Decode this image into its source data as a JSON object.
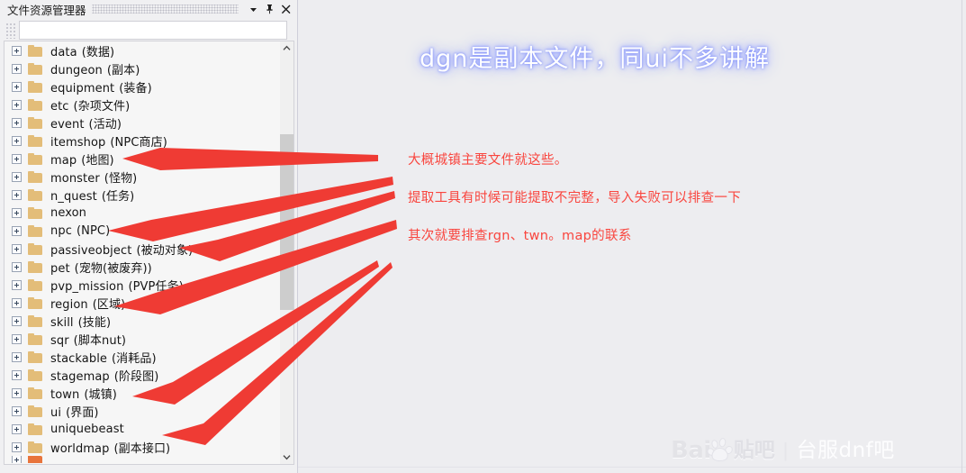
{
  "panel": {
    "title": "文件资源管理器",
    "titlebar_buttons": [
      {
        "name": "dropdown",
        "glyph": "▾"
      },
      {
        "name": "pin",
        "glyph": "pin"
      },
      {
        "name": "close",
        "glyph": "✕"
      }
    ],
    "search": {
      "value": "",
      "placeholder": ""
    },
    "scroll": {
      "up_glyph": "⌃",
      "down_glyph": "⌄"
    },
    "tree": [
      {
        "name": "data",
        "cn": "(数据)"
      },
      {
        "name": "dungeon",
        "cn": "(副本)"
      },
      {
        "name": "equipment",
        "cn": "(装备)"
      },
      {
        "name": "etc",
        "cn": "(杂项文件)"
      },
      {
        "name": "event",
        "cn": "(活动)"
      },
      {
        "name": "itemshop",
        "cn": "(NPC商店)"
      },
      {
        "name": "map",
        "cn": "(地图)"
      },
      {
        "name": "monster",
        "cn": "(怪物)"
      },
      {
        "name": "n_quest",
        "cn": "(任务)"
      },
      {
        "name": "nexon",
        "cn": ""
      },
      {
        "name": "npc",
        "cn": "(NPC)"
      },
      {
        "name": "passiveobject",
        "cn": "(被动对象)"
      },
      {
        "name": "pet",
        "cn": "(宠物(被废弃))"
      },
      {
        "name": "pvp_mission",
        "cn": "(PVP任务)"
      },
      {
        "name": "region",
        "cn": "(区域)"
      },
      {
        "name": "skill",
        "cn": "(技能)"
      },
      {
        "name": "sqr",
        "cn": "(脚本nut)"
      },
      {
        "name": "stackable",
        "cn": "(消耗品)"
      },
      {
        "name": "stagemap",
        "cn": "(阶段图)"
      },
      {
        "name": "town",
        "cn": "(城镇)"
      },
      {
        "name": "ui",
        "cn": "(界面)"
      },
      {
        "name": "uniquebeast",
        "cn": ""
      },
      {
        "name": "worldmap",
        "cn": "(副本接口)"
      }
    ]
  },
  "content": {
    "headline": "dgn是副本文件，同ui不多讲解",
    "notes": [
      "大概城镇主要文件就这些。",
      "提取工具有时候可能提取不完整，导入失败可以排查一下",
      "其次就要排查rgn、twn。map的联系"
    ]
  },
  "watermark": {
    "baidu": "Bai",
    "tieba": "贴吧",
    "separator": "|",
    "forum": "台服dnf吧"
  },
  "colors": {
    "background": "#ededf0",
    "panel": "#f0f0f2",
    "tree_bg": "#f6f6f6",
    "folder": "#e3bd79",
    "arrow_red": "#ef3b34",
    "note_red": "#f9463f",
    "headline_glow": "#93a0fb"
  }
}
